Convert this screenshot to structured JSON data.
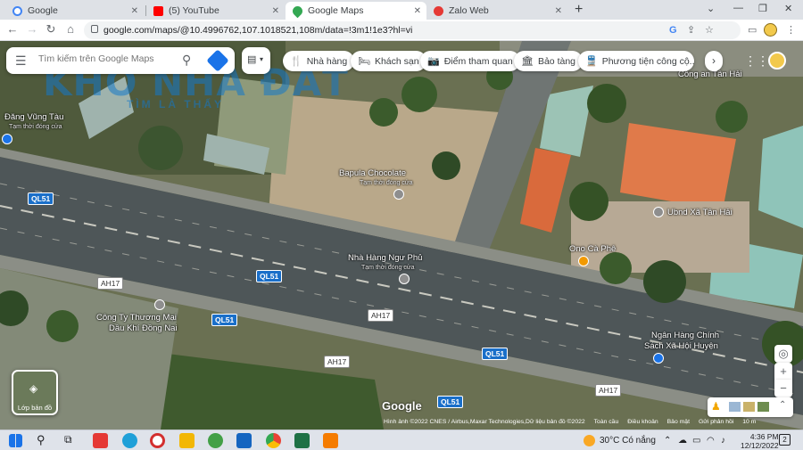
{
  "browser": {
    "tabs": [
      {
        "label": "Google",
        "icon": "google-g-icon",
        "color": "#4285f4"
      },
      {
        "label": "(5) YouTube",
        "icon": "youtube-icon",
        "color": "#ff0000"
      },
      {
        "label": "Google Maps",
        "icon": "google-maps-pin-icon",
        "color": "#34a853",
        "active": true
      },
      {
        "label": "Zalo Web",
        "icon": "zalo-icon",
        "color": "#e53935"
      }
    ],
    "url": "google.com/maps/@10.4996762,107.1018521,108m/data=!3m1!1e3?hl=vi"
  },
  "maps": {
    "search_placeholder": "Tìm kiếm trên Google Maps",
    "watermark": "KHO NHÀ ĐẤT",
    "watermark_sub": "TÌM LÀ THẤY",
    "chips": [
      {
        "label": "Nhà hàng",
        "icon": "restaurant-icon"
      },
      {
        "label": "Khách sạn",
        "icon": "hotel-icon"
      },
      {
        "label": "Điểm tham quan",
        "icon": "camera-icon"
      },
      {
        "label": "Bảo tàng",
        "icon": "museum-icon"
      },
      {
        "label": "Phương tiện công cộ...",
        "icon": "transit-icon"
      }
    ],
    "layer_button_label": "Lớp bản đồ",
    "logo": "Google",
    "attribution": "Hình ảnh ©2022 CNES / Airbus,Maxar Technologies,Dữ liệu bản đồ ©2022",
    "footer_links": [
      "Toàn cầu",
      "Điều khoản",
      "Bảo mật",
      "Gửi phản hồi"
    ],
    "scale": "10 m"
  },
  "map_labels": [
    {
      "text": "Đăng Vũng Tàu",
      "sub": "Tạm thời đóng cửa"
    },
    {
      "text": "Bapula Chocolate",
      "sub": "Tạm thời đóng cửa"
    },
    {
      "text": "Nhà Hàng Ngư Phủ",
      "sub": "Tạm thời đóng cửa"
    },
    {
      "text": "Ono Cà Phê",
      "sub": ""
    },
    {
      "text": "Ubnd Xã Tân Hải",
      "sub": ""
    },
    {
      "text": "Công Ty Thương Mại",
      "sub": "Dầu Khí Đồng Nai"
    },
    {
      "text": "Ngân Hàng Chính",
      "sub": "Sách Xã Hội Huyện"
    },
    {
      "text": "Công an Tân Hải",
      "sub": ""
    }
  ],
  "road_shields": [
    "QL51",
    "QL51",
    "QL51",
    "QL51",
    "QL51"
  ],
  "route_labels": [
    "AH17",
    "AH17",
    "AH17",
    "AH17"
  ],
  "taskbar": {
    "weather": "30°C Có nắng",
    "time": "4:36 PM",
    "date": "12/12/2022",
    "notifications": "2"
  }
}
